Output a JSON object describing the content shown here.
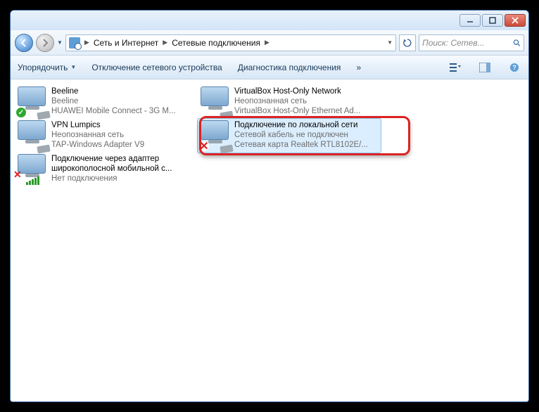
{
  "titlebar": {},
  "breadcrumb": {
    "root": "Сеть и Интернет",
    "current": "Сетевые подключения"
  },
  "search": {
    "placeholder": "Поиск: Сетев..."
  },
  "toolbar": {
    "organize": "Упорядочить",
    "disable": "Отключение сетевого устройства",
    "diagnose": "Диагностика подключения",
    "more": "»"
  },
  "items": [
    {
      "name": "Beeline",
      "status": "Beeline",
      "device": "HUAWEI Mobile Connect - 3G M...",
      "badge": "ok"
    },
    {
      "name": "VirtualBox Host-Only Network",
      "status": "Неопознанная сеть",
      "device": "VirtualBox Host-Only Ethernet Ad...",
      "badge": ""
    },
    {
      "name": "VPN Lumpics",
      "status": "Неопознанная сеть",
      "device": "TAP-Windows Adapter V9",
      "badge": ""
    },
    {
      "name": "Подключение по локальной сети",
      "status": "Сетевой кабель не подключен",
      "device": "Сетевая карта Realtek RTL8102E/...",
      "badge": "x",
      "selected": true
    },
    {
      "name": "Подключение через адаптер широкополосной мобильной с...",
      "status": "Нет подключения",
      "device": "",
      "badge": "bars"
    }
  ]
}
